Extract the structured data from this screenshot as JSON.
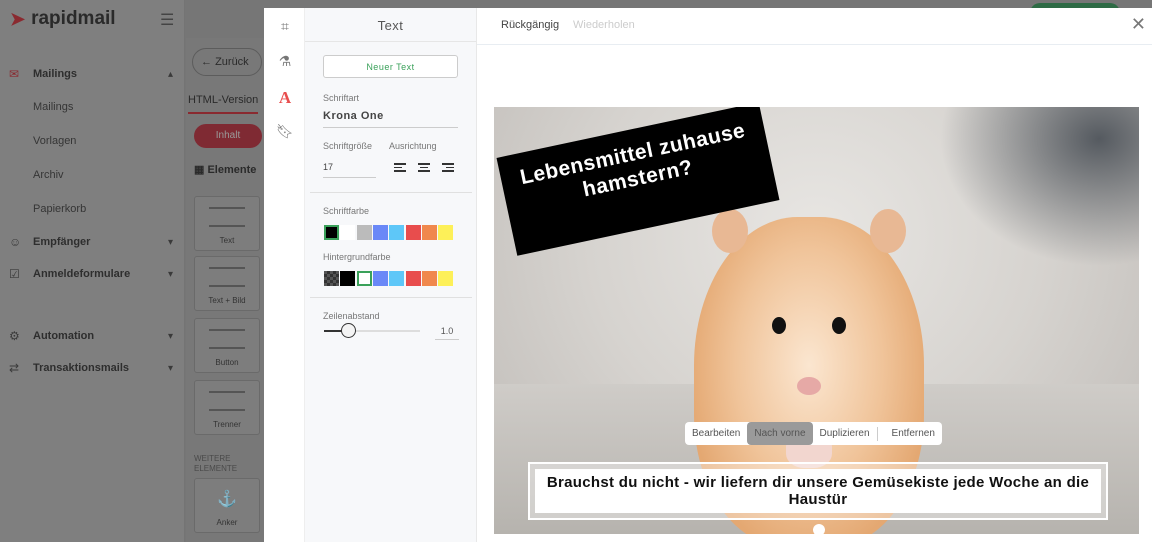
{
  "app": {
    "logo": "rapidmail"
  },
  "sidebar": {
    "items": [
      {
        "label": "Mailings",
        "icon": "mail-icon",
        "expanded": true,
        "subitems": [
          "Mailings",
          "Vorlagen",
          "Archiv",
          "Papierkorb"
        ]
      },
      {
        "label": "Empfänger",
        "icon": "user-icon"
      },
      {
        "label": "Anmeldeformulare",
        "icon": "checkbox-icon"
      },
      {
        "label": "Automation",
        "icon": "robot-icon"
      },
      {
        "label": "Transaktionsmails",
        "icon": "arrows-icon"
      }
    ]
  },
  "editor": {
    "back": "Zurück",
    "tab": "HTML-Version",
    "content_tab": "Inhalt",
    "elements_title": "Elemente",
    "blocks": [
      "Text",
      "Text + Bild",
      "Button",
      "Trenner"
    ],
    "more": "WEITERE ELEMENTE",
    "anchor": "Anker"
  },
  "image_editor": {
    "tools": [
      "crop-icon",
      "filter-icon",
      "text-icon",
      "sticker-icon"
    ],
    "panel": {
      "title": "Text",
      "new_text": "Neuer Text",
      "font_label": "Schriftart",
      "font": "Krona One",
      "size_label": "Schriftgröße",
      "size": "17",
      "align_label": "Ausrichtung",
      "font_color_label": "Schriftfarbe",
      "font_colors": [
        "#000000",
        "#ffffff",
        "#bbbbbb",
        "#6a88f7",
        "#5ec7f8",
        "#e84d4d",
        "#f0884d",
        "#fdf058"
      ],
      "bg_color_label": "Hintergrundfarbe",
      "bg_colors": [
        "transparent",
        "#000000",
        "#ffffff",
        "#6a88f7",
        "#5ec7f8",
        "#e84d4d",
        "#f0884d",
        "#fdf058"
      ],
      "line_height_label": "Zeilenabstand",
      "line_height": "1.0"
    },
    "toolbar": {
      "undo": "Rückgängig",
      "redo": "Wiederholen"
    },
    "image": {
      "headline": "Lebensmittel zuhause hamstern?",
      "caption": "Brauchst du nicht - wir liefern dir unsere Gemüsekiste jede Woche an die Haustür"
    },
    "context_menu": [
      "Bearbeiten",
      "Nach vorne",
      "Duplizieren",
      "Entfernen"
    ]
  }
}
